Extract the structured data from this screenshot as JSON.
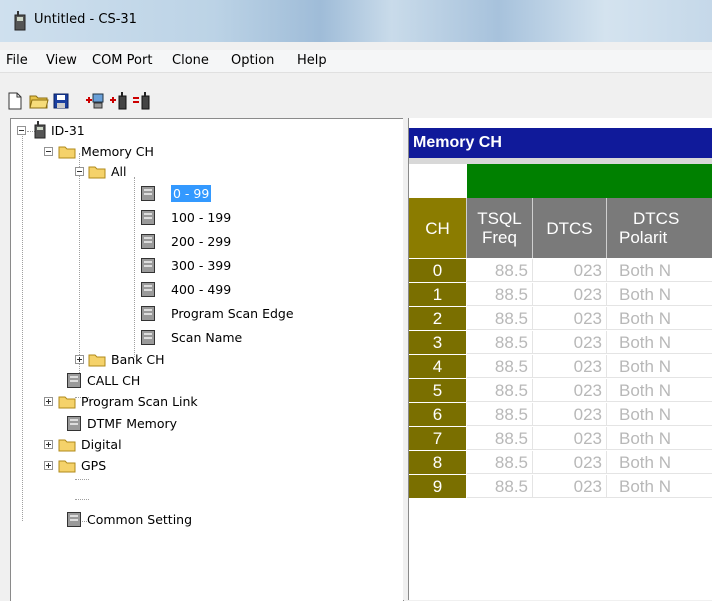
{
  "window": {
    "title": "Untitled - CS-31"
  },
  "menu": [
    {
      "label": "File",
      "name": "menu-file"
    },
    {
      "label": "View",
      "name": "menu-view"
    },
    {
      "label": "COM Port",
      "name": "menu-com-port"
    },
    {
      "label": "Clone",
      "name": "menu-clone"
    },
    {
      "label": "Option",
      "name": "menu-option"
    },
    {
      "label": "Help",
      "name": "menu-help"
    }
  ],
  "toolbar": {
    "buttons": [
      "new-file-icon",
      "open-folder-icon",
      "save-icon",
      "read-from-radio-icon",
      "write-to-radio-icon",
      "clone-radio-icon"
    ]
  },
  "tree": {
    "root": "ID-31",
    "memory_ch": "Memory CH",
    "all": "All",
    "ranges": [
      "0 - 99",
      "100 - 199",
      "200 - 299",
      "300 - 399",
      "400 - 499"
    ],
    "program_scan_edge": "Program Scan Edge",
    "scan_name": "Scan Name",
    "bank_ch": "Bank CH",
    "call_ch": "CALL CH",
    "program_scan_link": "Program Scan Link",
    "dtmf_memory": "DTMF Memory",
    "digital": "Digital",
    "gps": "GPS",
    "common_setting": "Common Setting",
    "selected": "0 - 99"
  },
  "memory_panel": {
    "title": "Memory CH",
    "columns": {
      "ch": "CH",
      "tsql": "TSQL Freq",
      "tsql_l1": "TSQL",
      "tsql_l2": "Freq",
      "dtcs": "DTCS",
      "pol_l1": "DTCS",
      "pol_l2": "Polarit"
    },
    "rows": [
      {
        "ch": "0",
        "tsql": "88.5",
        "dtcs": "023",
        "pol": "Both N"
      },
      {
        "ch": "1",
        "tsql": "88.5",
        "dtcs": "023",
        "pol": "Both N"
      },
      {
        "ch": "2",
        "tsql": "88.5",
        "dtcs": "023",
        "pol": "Both N"
      },
      {
        "ch": "3",
        "tsql": "88.5",
        "dtcs": "023",
        "pol": "Both N"
      },
      {
        "ch": "4",
        "tsql": "88.5",
        "dtcs": "023",
        "pol": "Both N"
      },
      {
        "ch": "5",
        "tsql": "88.5",
        "dtcs": "023",
        "pol": "Both N"
      },
      {
        "ch": "6",
        "tsql": "88.5",
        "dtcs": "023",
        "pol": "Both N"
      },
      {
        "ch": "7",
        "tsql": "88.5",
        "dtcs": "023",
        "pol": "Both N"
      },
      {
        "ch": "8",
        "tsql": "88.5",
        "dtcs": "023",
        "pol": "Both N"
      },
      {
        "ch": "9",
        "tsql": "88.5",
        "dtcs": "023",
        "pol": "Both N"
      }
    ]
  },
  "colors": {
    "header_blue": "#101a9a",
    "green_band": "#008000",
    "ch_olive": "#7a6f00",
    "gray_head": "#7a7a7a",
    "selection": "#3399ff"
  }
}
